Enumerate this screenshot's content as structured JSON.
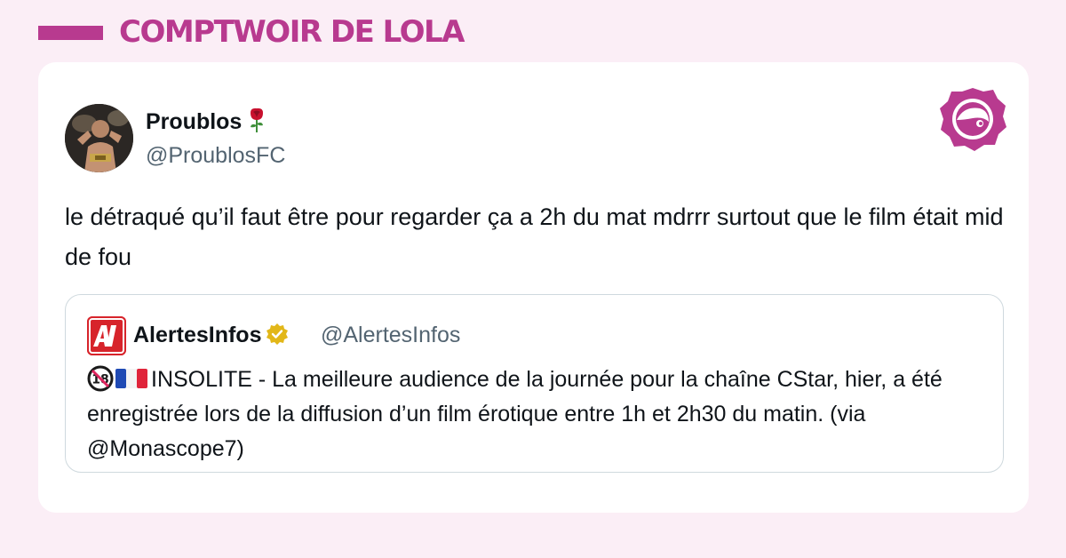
{
  "brand": {
    "name": "COMPTWOIR DE LOLA",
    "color": "#b83a8f"
  },
  "tweet": {
    "display_name": "Proublos",
    "name_emoji": "rose-icon",
    "handle": "@ProublosFC",
    "text": "le détraqué qu’il faut être pour regarder ça a 2h du mat mdrrr surtout que le film était mid de fou"
  },
  "quoted_tweet": {
    "display_name": "AlertesInfos",
    "verified": "verified-badge-icon",
    "handle": "@AlertesInfos",
    "emoji_1": "no-under-18-icon",
    "emoji_2": "france-flag-icon",
    "text": "INSOLITE - La meilleure audience de la journée pour la chaîne CStar, hier, a été enregistrée lors de la diffusion d’un film érotique entre 1h et 2h30 du matin. (via @Monascope7)"
  },
  "colors": {
    "background": "#fbeef6",
    "card": "#ffffff",
    "text": "#0f1419",
    "muted": "#536471",
    "border": "#cfd9de",
    "alertes_red": "#d7242b",
    "verified_gold": "#e2b719"
  }
}
